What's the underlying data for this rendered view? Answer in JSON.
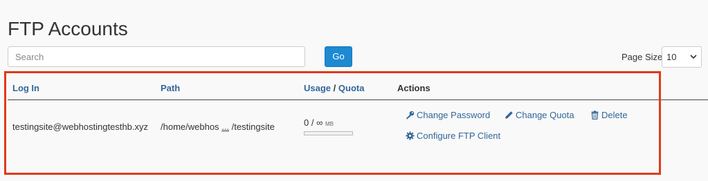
{
  "header": {
    "title": "FTP Accounts"
  },
  "search": {
    "placeholder": "Search",
    "value": ""
  },
  "go_label": "Go",
  "page_size": {
    "label": "Page Size",
    "value": "10"
  },
  "table": {
    "columns": {
      "login": "Log In",
      "path": "Path",
      "usage": "Usage",
      "slash": "/",
      "quota": "Quota",
      "actions": "Actions"
    },
    "rows": [
      {
        "login": "testingsite@webhostingtesthb.xyz",
        "path_start": "/home/webhos",
        "path_ellipsis": "...",
        "path_end": "/testingsite",
        "usage_text": "0 / ∞",
        "usage_unit": "MB",
        "usage_fraction": 0,
        "actions": {
          "change_password": "Change Password",
          "change_quota": "Change Quota",
          "delete": "Delete",
          "configure_client": "Configure FTP Client"
        }
      }
    ]
  },
  "colors": {
    "accent": "#1d8ad2",
    "link": "#336699",
    "highlight": "#e2391b"
  },
  "icons": [
    "key-icon",
    "pencil-icon",
    "trash-icon",
    "gear-icon",
    "chevron-down-icon"
  ]
}
